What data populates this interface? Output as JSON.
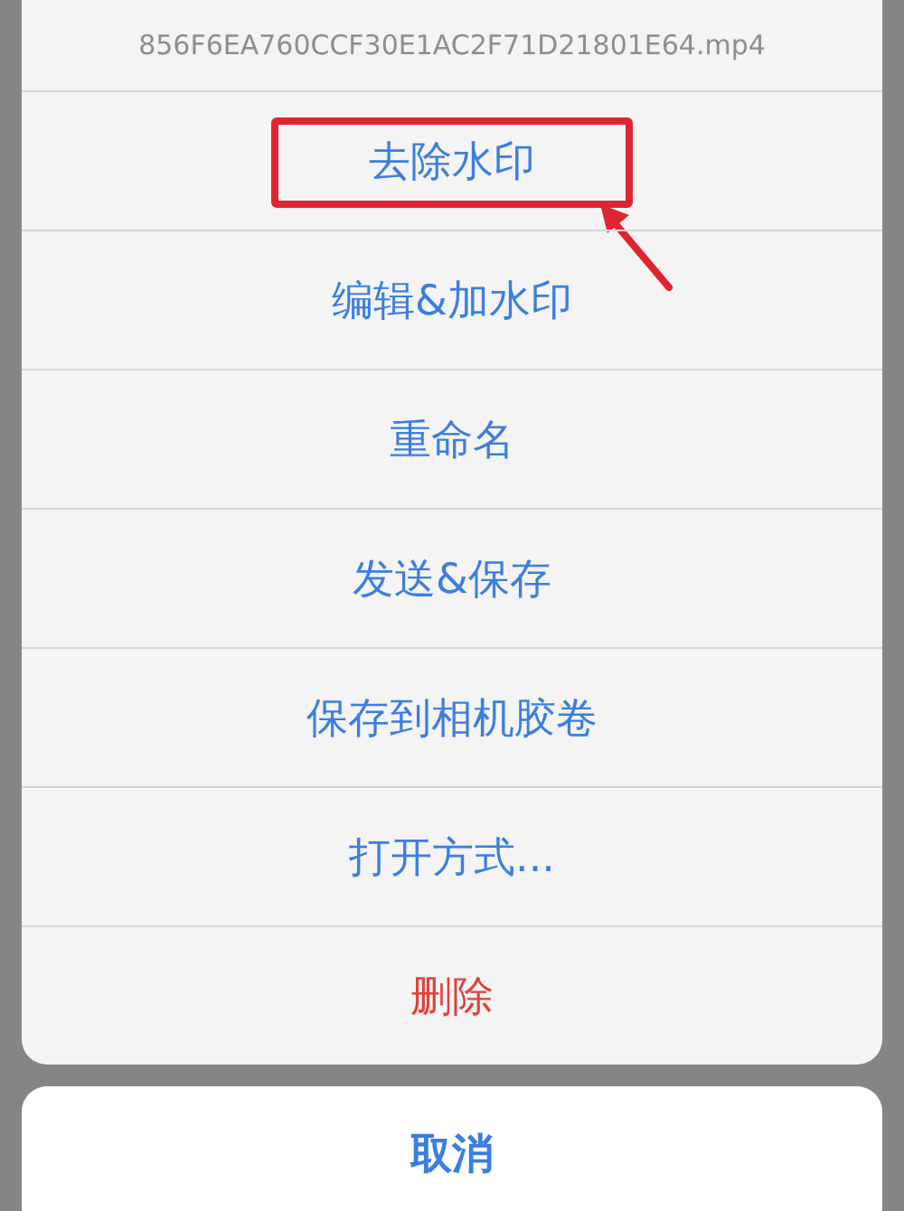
{
  "sheet": {
    "title": "856F6EA760CCF30E1AC2F71D21801E64.mp4",
    "actions": [
      {
        "label": "去除水印",
        "kind": "default",
        "highlighted": true
      },
      {
        "label": "编辑&加水印",
        "kind": "default",
        "highlighted": false
      },
      {
        "label": "重命名",
        "kind": "default",
        "highlighted": false
      },
      {
        "label": "发送&保存",
        "kind": "default",
        "highlighted": false
      },
      {
        "label": "保存到相机胶卷",
        "kind": "default",
        "highlighted": false
      },
      {
        "label": "打开方式...",
        "kind": "default",
        "highlighted": false
      },
      {
        "label": "删除",
        "kind": "destructive",
        "highlighted": false
      }
    ],
    "cancel": "取消"
  }
}
